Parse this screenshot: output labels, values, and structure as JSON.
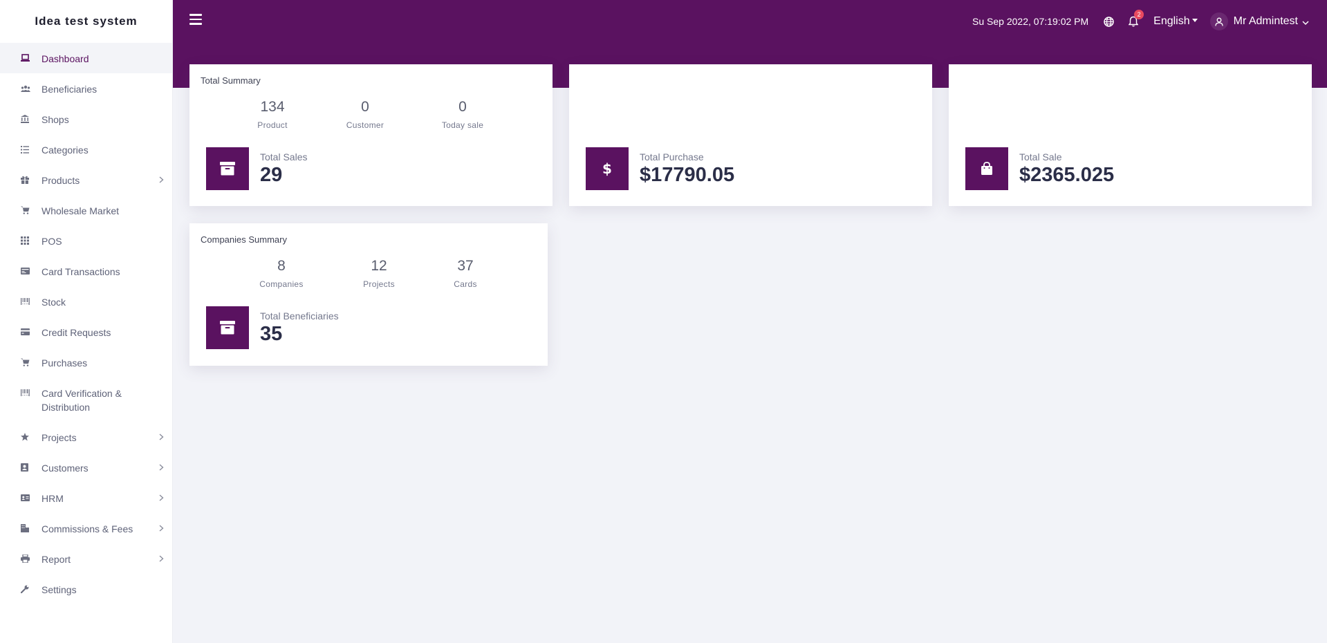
{
  "brand": "Idea test system",
  "sidebar": {
    "items": [
      {
        "label": "Dashboard",
        "icon": "laptop-icon"
      },
      {
        "label": "Beneficiaries",
        "icon": "users-icon"
      },
      {
        "label": "Shops",
        "icon": "bank-icon"
      },
      {
        "label": "Categories",
        "icon": "list-icon"
      },
      {
        "label": "Products",
        "icon": "gift-icon"
      },
      {
        "label": "Wholesale Market",
        "icon": "cart-icon"
      },
      {
        "label": "POS",
        "icon": "grid-icon"
      },
      {
        "label": "Card Transactions",
        "icon": "card-icon"
      },
      {
        "label": "Stock",
        "icon": "barcode-icon"
      },
      {
        "label": "Credit Requests",
        "icon": "credit-card-icon"
      },
      {
        "label": "Purchases",
        "icon": "cart-icon"
      },
      {
        "label": "Card Verification & Distribution",
        "icon": "barcode-icon"
      },
      {
        "label": "Projects",
        "icon": "star-icon"
      },
      {
        "label": "Customers",
        "icon": "contact-icon"
      },
      {
        "label": "HRM",
        "icon": "id-card-icon"
      },
      {
        "label": "Commissions & Fees",
        "icon": "building-icon"
      },
      {
        "label": "Report",
        "icon": "print-icon"
      },
      {
        "label": "Settings",
        "icon": "wrench-icon"
      }
    ]
  },
  "header": {
    "datetime": "Su Sep 2022, 07:19:02 PM",
    "notification_count": "2",
    "language": "English",
    "user_name": "Mr Admintest"
  },
  "total_summary": {
    "title": "Total Summary",
    "stats": [
      {
        "value": "134",
        "label": "Product"
      },
      {
        "value": "0",
        "label": "Customer"
      },
      {
        "value": "0",
        "label": "Today sale"
      }
    ],
    "big_label": "Total Sales",
    "big_value": "29"
  },
  "purchase_card": {
    "label": "Total Purchase",
    "value": "$17790.05"
  },
  "sale_card": {
    "label": "Total Sale",
    "value": "$2365.025"
  },
  "companies_summary": {
    "title": "Companies Summary",
    "stats": [
      {
        "value": "8",
        "label": "Companies"
      },
      {
        "value": "12",
        "label": "Projects"
      },
      {
        "value": "37",
        "label": "Cards"
      }
    ],
    "big_label": "Total Beneficiaries",
    "big_value": "35"
  },
  "colors": {
    "primary": "#5a1260",
    "background": "#f2f3f8",
    "badge": "#e84a5f"
  }
}
